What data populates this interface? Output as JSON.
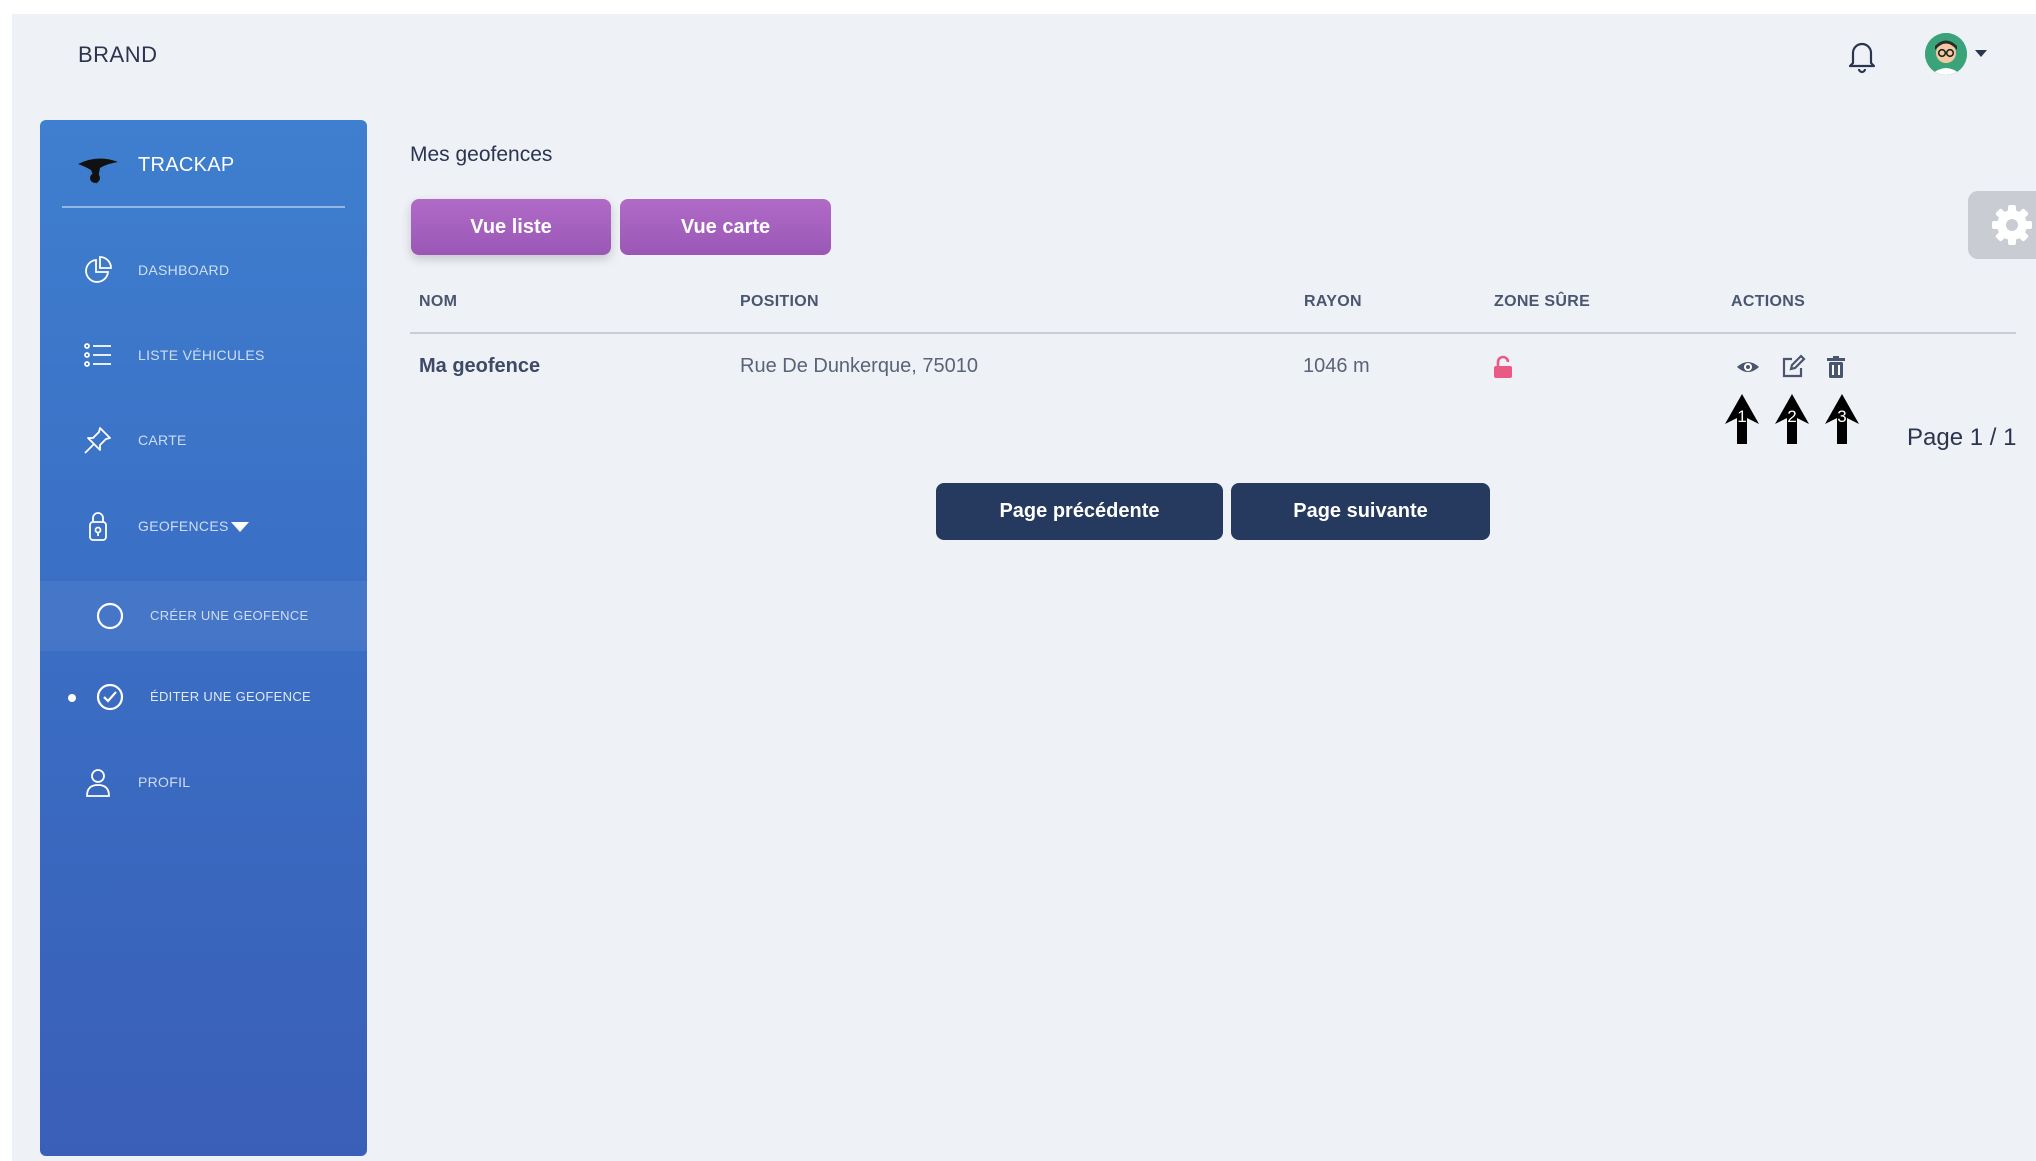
{
  "header": {
    "brand": "BRAND",
    "notifications_icon": "bell-icon",
    "avatar_icon": "user-avatar-icon"
  },
  "sidebar": {
    "app_name": "TRACKAP",
    "items": [
      {
        "label": "DASHBOARD",
        "icon": "pie-chart-icon"
      },
      {
        "label": "LISTE VÉHICULES",
        "icon": "list-icon"
      },
      {
        "label": "CARTE",
        "icon": "pin-icon"
      },
      {
        "label": "GEOFENCES",
        "icon": "location-lock-icon"
      },
      {
        "label": "CRÉER UNE GEOFENCE",
        "icon": "circle-icon"
      },
      {
        "label": "ÉDITER UNE GEOFENCE",
        "icon": "check-circle-icon",
        "active": true
      },
      {
        "label": "PROFIL",
        "icon": "user-icon"
      }
    ]
  },
  "main": {
    "title": "Mes geofences",
    "view_buttons": {
      "list": "Vue liste",
      "map": "Vue carte"
    },
    "table": {
      "headers": [
        "NOM",
        "POSITION",
        "RAYON",
        "ZONE SÛRE",
        "ACTIONS"
      ],
      "rows": [
        {
          "name": "Ma geofence",
          "position": "Rue De Dunkerque, 75010",
          "radius": "1046 m",
          "safe_zone_icon": "unlocked-icon",
          "actions": [
            "view-icon",
            "edit-icon",
            "delete-icon"
          ]
        }
      ],
      "annotations": [
        "1",
        "2",
        "3"
      ]
    },
    "pagination": {
      "label": "Page 1 / 1",
      "previous": "Page précédente",
      "next": "Page suivante"
    }
  },
  "colors": {
    "sidebar": "#3a6fc5",
    "view_button": "#a661c0",
    "page_button": "#253a5e",
    "lock": "#e95a84"
  }
}
